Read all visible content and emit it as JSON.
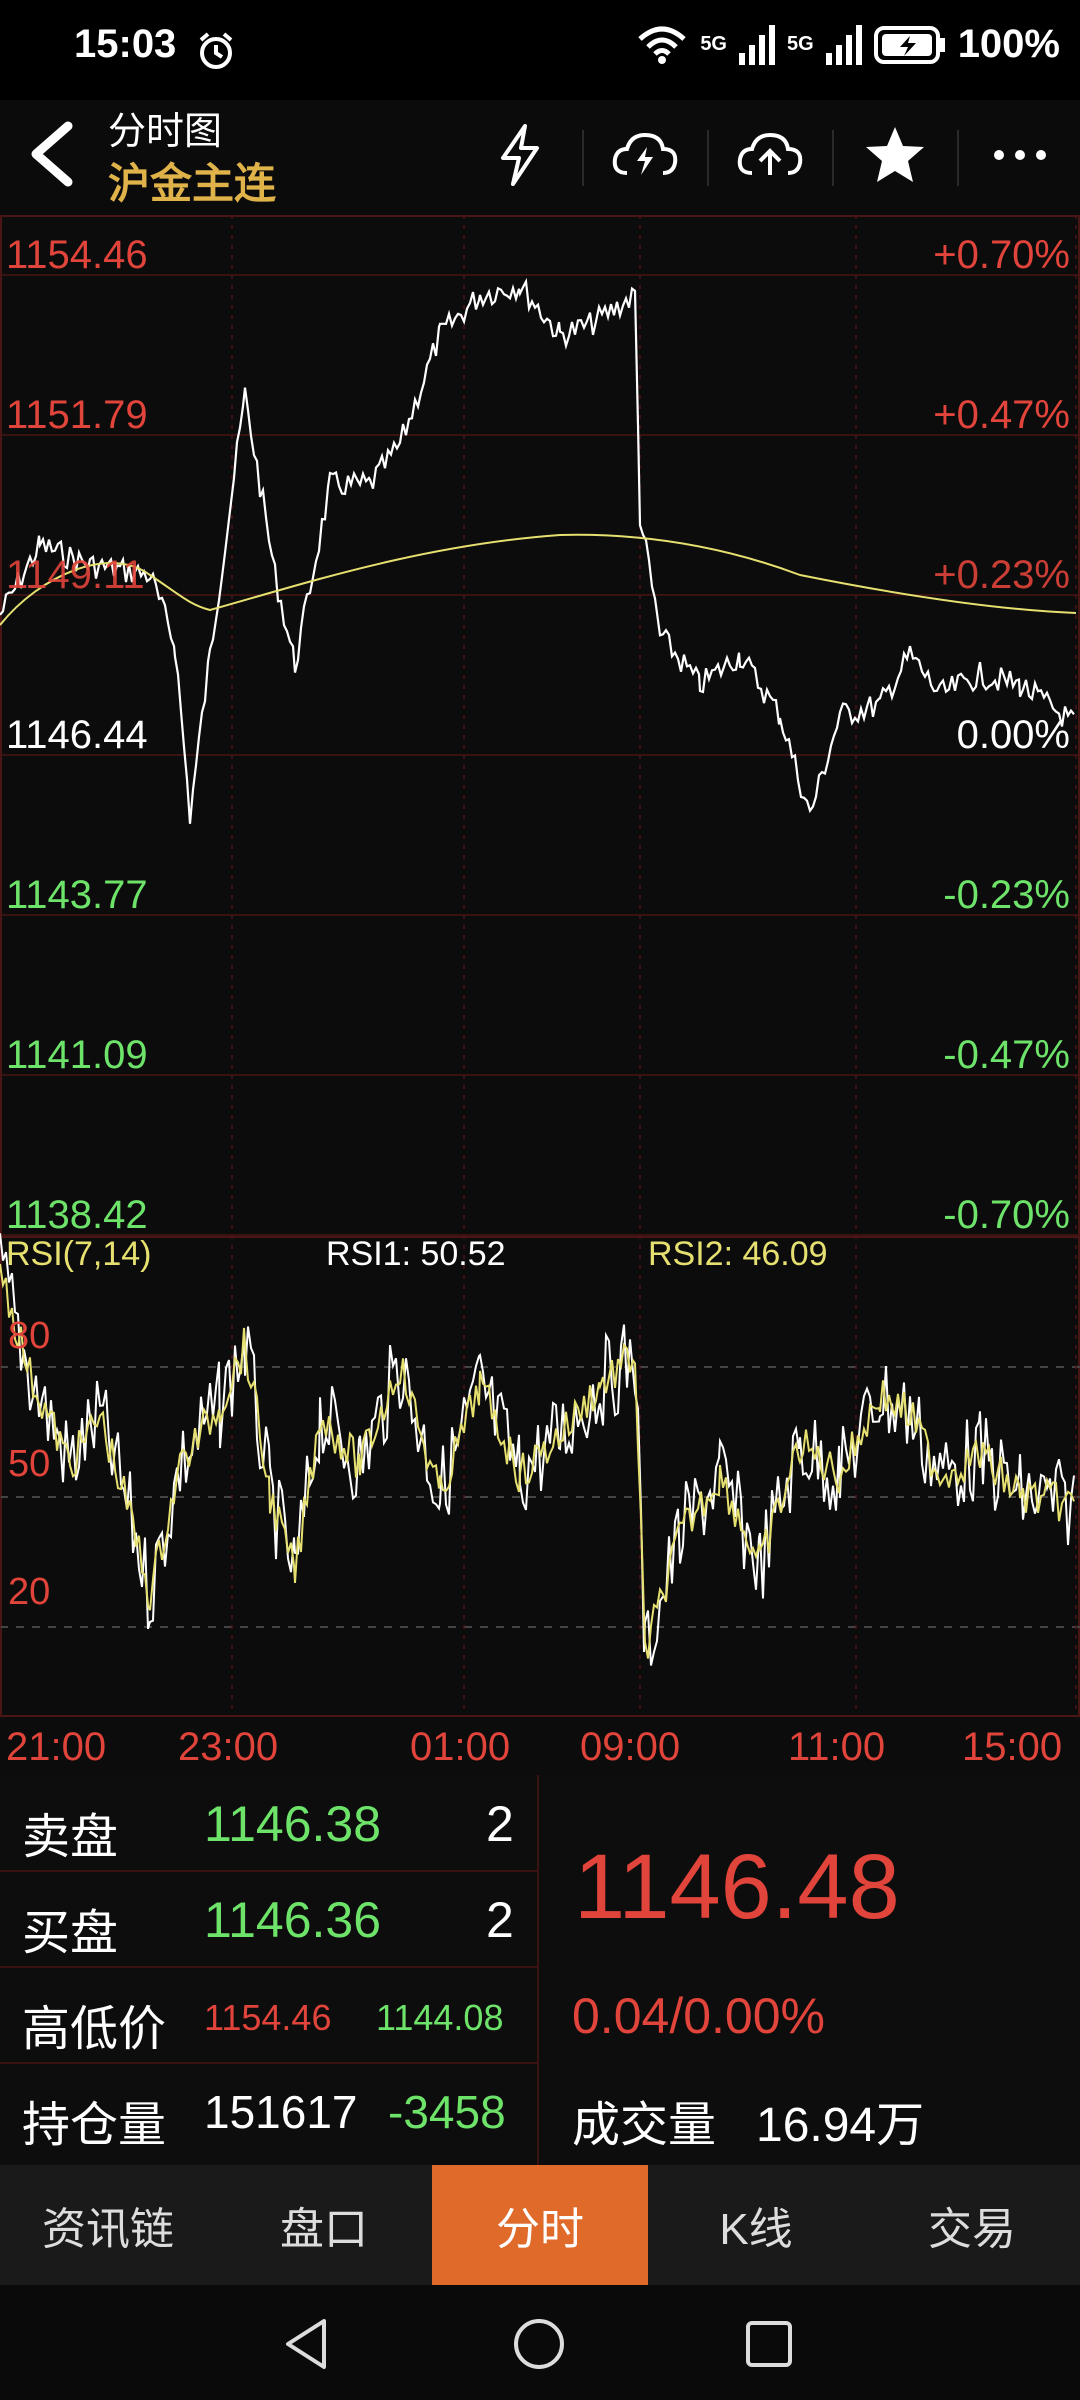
{
  "status": {
    "time": "15:03",
    "signal1": "5G",
    "signal2": "5G",
    "battery": "100%"
  },
  "header": {
    "title": "分时图",
    "subtitle": "沪金主连"
  },
  "price_axis": {
    "left": [
      "1154.46",
      "1151.79",
      "1149.11",
      "1146.44",
      "1143.77",
      "1141.09",
      "1138.42"
    ],
    "right": [
      "+0.70%",
      "+0.47%",
      "+0.23%",
      "0.00%",
      "-0.23%",
      "-0.47%",
      "-0.70%"
    ]
  },
  "rsi": {
    "title": "RSI(7,14)",
    "rsi1": "RSI1: 50.52",
    "rsi2": "RSI2: 46.09",
    "ticks": [
      "80",
      "50",
      "20"
    ]
  },
  "time_axis": [
    "21:00",
    "23:00",
    "01:00",
    "09:00",
    "11:00",
    "15:00"
  ],
  "quote": {
    "sell_label": "卖盘",
    "sell_price": "1146.38",
    "sell_qty": "2",
    "buy_label": "买盘",
    "buy_price": "1146.36",
    "buy_qty": "2",
    "hl_label": "高低价",
    "high": "1154.46",
    "low": "1144.08",
    "oi_label": "持仓量",
    "oi": "151617",
    "oi_change": "-3458",
    "last_price": "1146.48",
    "change": "0.04/0.00%",
    "vol_label": "成交量",
    "volume": "16.94万"
  },
  "tabs": [
    "资讯链",
    "盘口",
    "分时",
    "K线",
    "交易"
  ],
  "colors": {
    "up": "#e0443a",
    "down": "#6ee36a",
    "accent": "#e06a2a",
    "avg_line": "#e6e070",
    "subtitle": "#e0b24a"
  }
}
